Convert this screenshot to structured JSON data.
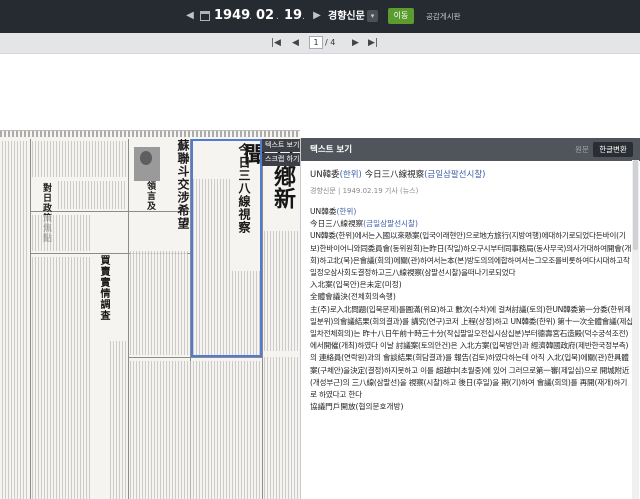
{
  "topbar": {
    "year": "1949",
    "month": "02",
    "day": "19",
    "year_suffix": ".",
    "month_suffix": ".",
    "day_suffix": ".",
    "newspaper": "경향신문",
    "go_label": "이동",
    "notice_label": "공감게시판"
  },
  "pager": {
    "current": "1",
    "total": "/ 4"
  },
  "newspaper_page": {
    "masthead": "京鄕新聞",
    "headline_main": "今日三八線視察",
    "headline_1": "蘇聯斗交涉希望",
    "headline_2": "對日政策焦點",
    "headline_3": "買賣實情調査",
    "headline_4": "李大統領言及"
  },
  "tooltip": {
    "text_view": "텍스트 보기",
    "scrap": "스크랩 하기"
  },
  "panel": {
    "title": "텍스트 보기",
    "toggle_original": "원문",
    "toggle_hangul": "한글변환",
    "article_title_a": "UN韓委",
    "article_title_a_read": "(한위)",
    "article_title_b": " 今日三八線視察",
    "article_title_b_read": "(금일삼팔선시찰)",
    "meta": "경향신문 | 1949.02.19 기사 (뉴스)",
    "body": [
      {
        "t": "UN韓委",
        "r": "(한위)"
      },
      {
        "t": "今日三八線視察",
        "r": "(금일삼팔선시찰)"
      },
      {
        "t": "UN韓委(한위)에서는入國以來懸案(입국이래현안)으로地方旅行(지방여행)에대하기로되었다든바이(기보)한바이어니와同委員會(동위원회)는昨日(작일)하오구시부터同事務局(동사무국)의사가대하여開會(개회)하고北(북)은會議(회의)에關(관)하여서는本(본)방도의의에합하여서는그오조를비롯하여다시대하고작일정오삼사회도결정하고三八線視察(삼팔선시찰)을떠나기로되었다"
      },
      {
        "t": "入北案(입북안)은未定(미정)"
      },
      {
        "t": "全體會議決(전체회의속행)"
      },
      {
        "t": "主(주)로入北問題(입북문제)를圓滿(위요)하고 數次(수차)에 걸쳐討議(토의)한UN韓委第一分委(한위제일분위)의會議結果(회의결과)를 講究(연구)코저 上程(상정)하고 UN韓委(한위) 第十一次全體會議(제십일차전체회의)는 昨十八日午前十時三十分(작십팔일오전십시삼십분)부터德壽宮石造殿(덕수궁석조전)에서開催(개최)하였다 이날 討議案(토의안건)은 入北方案(입북방안)과 經濟韓國政府(제반한국정부측) 의 連絡員(연락원)과의 會談結果(회담결과)를 報告(검토)하였다하는데 아직 入北(입북)에關(관)한具體案(구체안)을決定(결정)하지못하고 이를 超越中(초월중)에 있어 그러므로第一審(제일심)으로 開城附近(개성부근)의 三八線(삼팔선)을 視察(시찰)하고 後日(후일)을 期(기)하여 會議(회의)를 再開(재개)하기로 하였다고 한다"
      },
      {
        "t": "協議門戶開放(협의문호개방)"
      }
    ]
  }
}
